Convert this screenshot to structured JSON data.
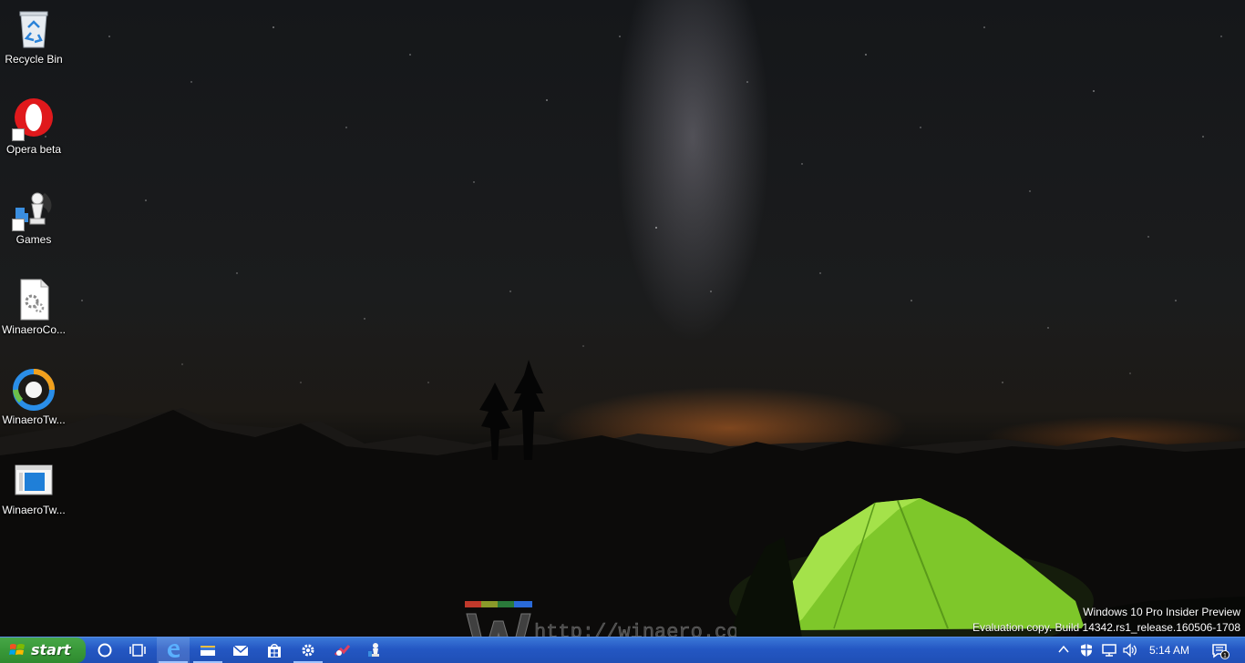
{
  "desktop": {
    "icons": [
      {
        "label": "Recycle Bin",
        "icon": "recycle-bin-icon"
      },
      {
        "label": "Opera beta",
        "icon": "opera-icon"
      },
      {
        "label": "Games",
        "icon": "games-icon"
      },
      {
        "label": "WinaeroCo...",
        "icon": "config-file-icon"
      },
      {
        "label": "WinaeroTw...",
        "icon": "winaero-tweaker-icon"
      },
      {
        "label": "WinaeroTw...",
        "icon": "window-app-icon"
      }
    ],
    "watermark": {
      "line1": "Windows 10 Pro Insider Preview",
      "line2": "Evaluation copy. Build 14342.rs1_release.160506-1708"
    },
    "brand_text": "http://winaero.com"
  },
  "taskbar": {
    "start_label": "start",
    "buttons": [
      {
        "name": "cortana-search",
        "icon": "circle-icon"
      },
      {
        "name": "task-view",
        "icon": "task-view-icon"
      },
      {
        "name": "edge",
        "icon": "edge-icon"
      },
      {
        "name": "file-explorer",
        "icon": "folder-icon"
      },
      {
        "name": "mail",
        "icon": "mail-icon"
      },
      {
        "name": "store",
        "icon": "store-icon"
      },
      {
        "name": "settings",
        "icon": "gear-icon"
      },
      {
        "name": "tweaker",
        "icon": "tweaker-icon"
      },
      {
        "name": "games",
        "icon": "chess-icon"
      }
    ],
    "tray": {
      "clock": "5:14 AM",
      "notification_count": "1"
    },
    "colors": {
      "taskbar": "#2457c3",
      "start": "#3a9a3a"
    }
  }
}
